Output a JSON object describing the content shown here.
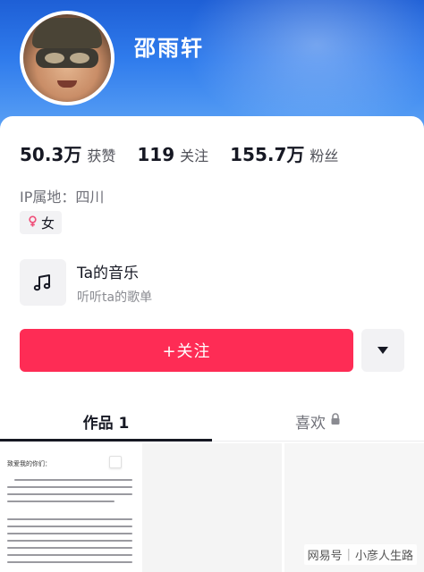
{
  "profile": {
    "name": "邵雨轩",
    "avatar_icon": "avatar-photo"
  },
  "stats": [
    {
      "value": "50.3万",
      "label": "获赞"
    },
    {
      "value": "119",
      "label": "关注"
    },
    {
      "value": "155.7万",
      "label": "粉丝"
    }
  ],
  "ip_location": "IP属地：四川",
  "gender": {
    "symbol": "⚥",
    "label": "女",
    "icon": "female-icon"
  },
  "music": {
    "title": "Ta的音乐",
    "subtitle": "听听ta的歌单",
    "icon": "music-note-icon"
  },
  "actions": {
    "follow_label": "+关注",
    "more_icon": "triangle-down-icon"
  },
  "tabs": [
    {
      "label": "作品 1",
      "active": true
    },
    {
      "label": "喜欢",
      "active": false,
      "icon": "lock-icon"
    }
  ],
  "thumbnail": {
    "heading": "致爱我的你们："
  },
  "watermark": {
    "left": "网易号",
    "right": "小彦人生路"
  },
  "colors": {
    "header_blue": "#2f7bec",
    "follow_red": "#fe2c55",
    "gender_pink": "#f0507a"
  }
}
